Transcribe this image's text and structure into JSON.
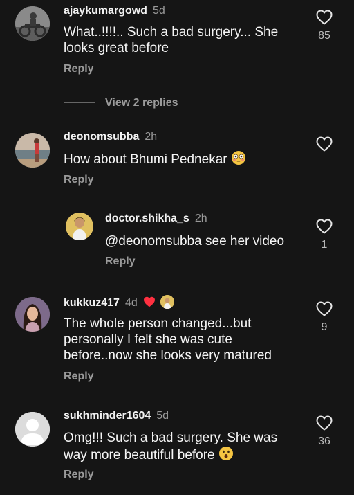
{
  "comments": [
    {
      "username": "ajaykumargowd",
      "time": "5d",
      "text": "What..!!!!.. Such a bad surgery... She looks great before",
      "reply_label": "Reply",
      "likes": "85"
    },
    {
      "username": "deonomsubba",
      "time": "2h",
      "text": "How about Bhumi Pednekar",
      "reply_label": "Reply",
      "likes": ""
    },
    {
      "username": "kukkuz417",
      "time": "4d",
      "text": "The whole person changed...but personally I felt she was cute before..now she looks very matured",
      "reply_label": "Reply",
      "likes": "9"
    },
    {
      "username": "sukhminder1604",
      "time": "5d",
      "text": "Omg!!! Such a bad surgery. She was way more beautiful before",
      "reply_label": "Reply",
      "likes": "36"
    }
  ],
  "view_replies": "View 2 replies",
  "reply_thread": {
    "username": "doctor.shikha_s",
    "time": "2h",
    "text": "@deonomsubba see her video",
    "reply_label": "Reply",
    "likes": "1"
  },
  "colors": {
    "background": "#151515",
    "text": "#f2f2f2",
    "muted": "#9a9a9a",
    "heart_red": "#ff3040"
  },
  "icons": {
    "like": "heart-outline-icon",
    "author_liked": "red-heart-icon",
    "emoji_flushed": "flushed-face-emoji",
    "emoji_surprised": "surprised-face-emoji"
  }
}
